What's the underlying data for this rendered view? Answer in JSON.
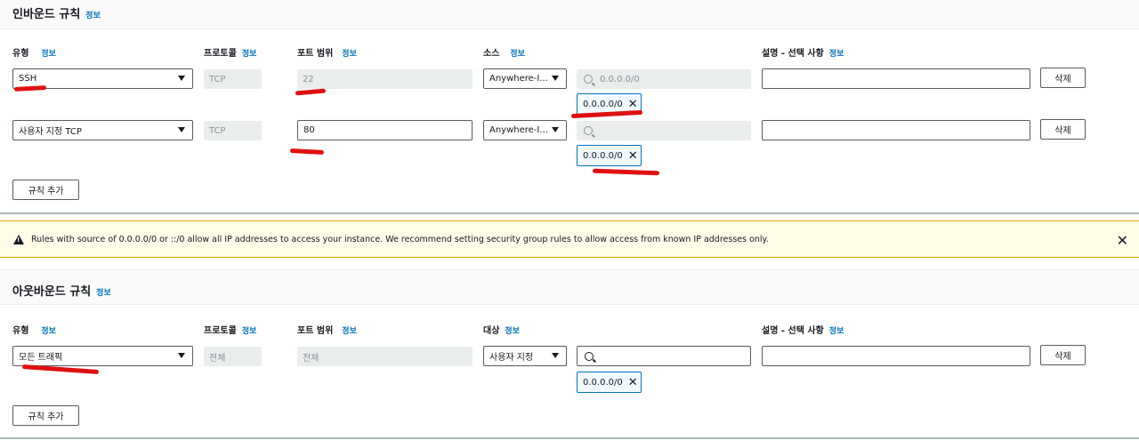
{
  "inbound": {
    "title": "인바운드 규칙",
    "info": "정보",
    "columns": {
      "type": "유형",
      "type_info": "정보",
      "protocol": "프로토콜",
      "protocol_info": "정보",
      "port_range": "포트 범위",
      "port_info": "정보",
      "source": "소스",
      "source_info": "정보",
      "description": "설명 - 선택 사항",
      "description_info": "정보"
    },
    "rules": [
      {
        "type": "SSH",
        "protocol": "TCP",
        "port": "22",
        "source": "Anywhere-I...",
        "search_placeholder": "0.0.0.0/0",
        "token": "0.0.0.0/0",
        "delete": "삭제"
      },
      {
        "type": "사용자 지정 TCP",
        "protocol": "TCP",
        "port": "80",
        "source": "Anywhere-I...",
        "search_placeholder": "",
        "token": "0.0.0.0/0",
        "delete": "삭제"
      }
    ],
    "add_rule": "규칙 추가"
  },
  "warning": {
    "text": "Rules with source of 0.0.0.0/0 or ::/0 allow all IP addresses to access your instance. We recommend setting security group rules to allow access from known IP addresses only."
  },
  "outbound": {
    "title": "아웃바운드 규칙",
    "info": "정보",
    "columns": {
      "type": "유형",
      "type_info": "정보",
      "protocol": "프로토콜",
      "protocol_info": "정보",
      "port_range": "포트 범위",
      "port_info": "정보",
      "destination": "대상",
      "destination_info": "정보",
      "description": "설명 - 선택 사항",
      "description_info": "정보"
    },
    "rules": [
      {
        "type": "모든 트래픽",
        "protocol": "전체",
        "port": "전체",
        "destination": "사용자 지정",
        "token": "0.0.0.0/0",
        "delete": "삭제"
      }
    ],
    "add_rule": "규칙 추가"
  },
  "colors": {
    "accent": "#0073bb",
    "warning_bg": "#fffce8",
    "annotation": "#e01010"
  }
}
